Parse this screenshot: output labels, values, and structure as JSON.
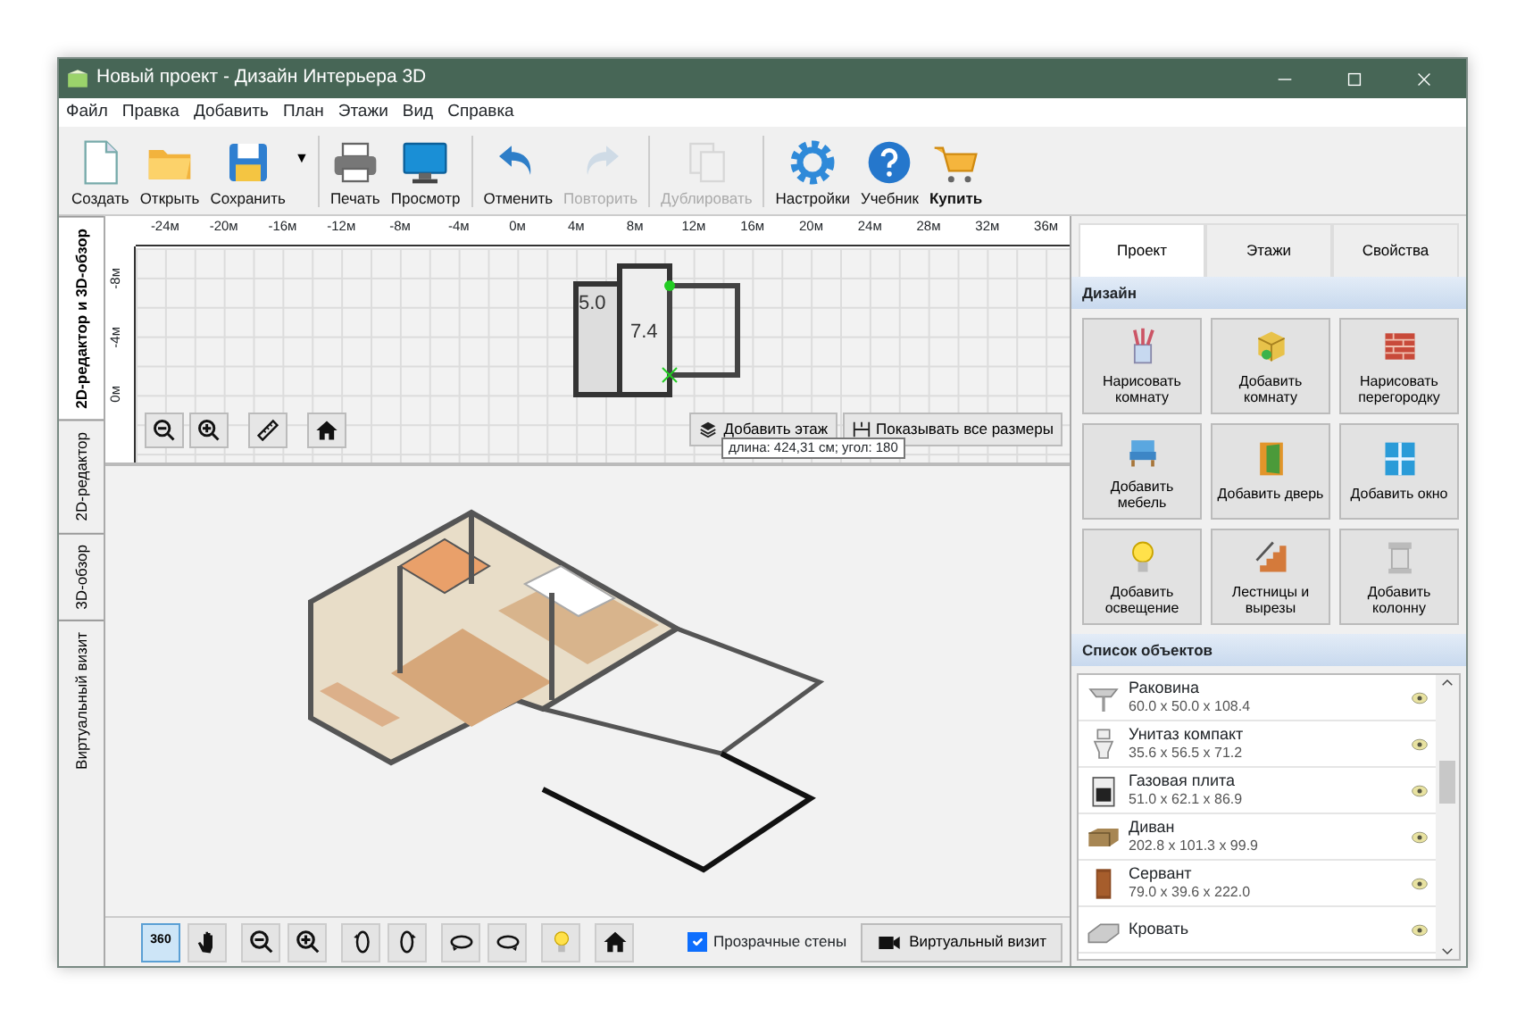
{
  "window": {
    "title": "Новый проект - Дизайн Интерьера 3D"
  },
  "menu": [
    "Файл",
    "Правка",
    "Добавить",
    "План",
    "Этажи",
    "Вид",
    "Справка"
  ],
  "toolbar": {
    "groups": [
      [
        {
          "label": "Создать",
          "disabled": false,
          "bold": false
        },
        {
          "label": "Открыть",
          "disabled": false,
          "bold": false
        },
        {
          "label": "Сохранить",
          "disabled": false,
          "bold": false,
          "dropdown": "▼"
        }
      ],
      [
        {
          "label": "Печать",
          "disabled": false,
          "bold": false
        },
        {
          "label": "Просмотр",
          "disabled": false,
          "bold": false
        }
      ],
      [
        {
          "label": "Отменить",
          "disabled": false,
          "bold": false
        },
        {
          "label": "Повторить",
          "disabled": true,
          "bold": false
        }
      ],
      [
        {
          "label": "Дублировать",
          "disabled": true,
          "bold": false
        }
      ],
      [
        {
          "label": "Настройки",
          "disabled": false,
          "bold": false
        },
        {
          "label": "Учебник",
          "disabled": false,
          "bold": false
        },
        {
          "label": "Купить",
          "disabled": false,
          "bold": true
        }
      ]
    ]
  },
  "side_tabs": [
    {
      "label": "2D-редактор и 3D-обзор",
      "selected": true
    },
    {
      "label": "2D-редактор",
      "selected": false
    },
    {
      "label": "3D-обзор",
      "selected": false
    },
    {
      "label": "Виртуальный визит",
      "selected": false
    }
  ],
  "editor_2d": {
    "x_ruler": [
      "-24м",
      "-20м",
      "-16м",
      "-12м",
      "-8м",
      "-4м",
      "0м",
      "4м",
      "8м",
      "12м",
      "16м",
      "20м",
      "24м",
      "28м",
      "32м",
      "36м"
    ],
    "y_ruler": [
      "-8м",
      "-4м",
      "0м"
    ],
    "room_labels": [
      "5.0",
      "7.4"
    ],
    "buttons": [
      "Добавить этаж",
      "Показывать все размеры"
    ],
    "tooltip": "длина: 424,31 см; угол: 180"
  },
  "view_3d": {
    "tools": [
      [
        {
          "label": "360",
          "selected": true
        },
        {
          "selected": false
        }
      ],
      [
        {
          "selected": false
        },
        {
          "selected": false
        }
      ],
      [
        {
          "selected": false
        },
        {
          "selected": false
        }
      ],
      [
        {
          "selected": false
        },
        {
          "selected": false
        }
      ],
      [
        {
          "selected": false
        }
      ],
      [
        {
          "selected": false
        }
      ]
    ],
    "transparent_walls": {
      "label": "Прозрачные стены",
      "checked": true
    },
    "visit_button": "Виртуальный визит"
  },
  "panel": {
    "tabs": [
      {
        "label": "Проект",
        "selected": true
      },
      {
        "label": "Этажи",
        "selected": false
      },
      {
        "label": "Свойства",
        "selected": false
      }
    ],
    "design": {
      "title": "Дизайн",
      "tiles": [
        "Нарисовать комнату",
        "Добавить комнату",
        "Нарисовать перегородку",
        "Добавить мебель",
        "Добавить дверь",
        "Добавить окно",
        "Добавить освещение",
        "Лестницы и вырезы",
        "Добавить колонну"
      ]
    },
    "objects": {
      "title": "Список объектов",
      "items": [
        {
          "name": "Раковина",
          "size": "60.0 x 50.0 x 108.4"
        },
        {
          "name": "Унитаз компакт",
          "size": "35.6 x 56.5 x 71.2"
        },
        {
          "name": "Газовая плита",
          "size": "51.0 x 62.1 x 86.9"
        },
        {
          "name": "Диван",
          "size": "202.8 x 101.3 x 99.9"
        },
        {
          "name": "Сервант",
          "size": "79.0 x 39.6 x 222.0"
        },
        {
          "name": "Кровать"
        }
      ]
    }
  }
}
